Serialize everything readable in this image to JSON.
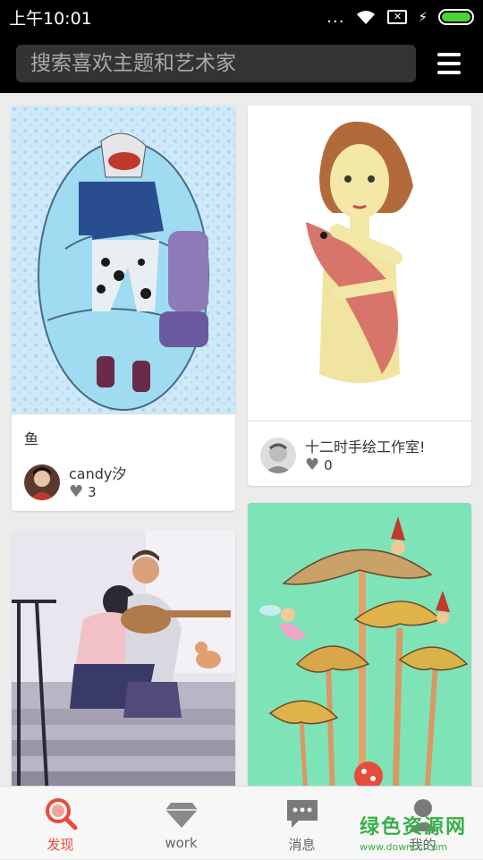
{
  "status": {
    "time": "上午10:01",
    "dots": "...",
    "charging": "⚡"
  },
  "search": {
    "placeholder": "搜索喜欢主题和艺术家"
  },
  "cards": [
    {
      "title": "鱼",
      "author": "candy汐",
      "likes": "3"
    },
    {
      "author": "十二时手绘工作室!",
      "likes": "0"
    }
  ],
  "tabs": [
    {
      "label": "发现"
    },
    {
      "label": "work"
    },
    {
      "label": "消息"
    },
    {
      "label": "我的"
    }
  ],
  "watermark": {
    "title": "绿色资源网",
    "url": "www.downcc.com"
  },
  "colors": {
    "accent": "#e84c3d",
    "battery": "#4cd137",
    "watermark": "#37b04a"
  }
}
